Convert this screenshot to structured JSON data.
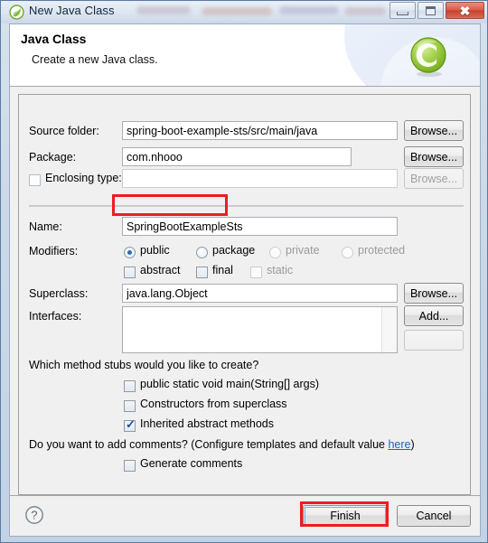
{
  "window": {
    "title": "New Java Class",
    "title_icon": "spring-leaf-icon",
    "minimize_label": "Minimize",
    "maximize_label": "Maximize",
    "close_label": "Close"
  },
  "banner": {
    "title": "Java Class",
    "subtitle": "Create a new Java class.",
    "icon": "java-class-icon"
  },
  "form": {
    "source_folder": {
      "label": "Source folder:",
      "value": "spring-boot-example-sts/src/main/java",
      "browse_label": "Browse..."
    },
    "package": {
      "label": "Package:",
      "value": "com.nhooo",
      "browse_label": "Browse..."
    },
    "enclosing_type": {
      "label": "Enclosing type:",
      "value": "",
      "checked": false,
      "browse_label": "Browse..."
    },
    "name": {
      "label": "Name:",
      "value": "SpringBootExampleSts"
    },
    "modifiers": {
      "label": "Modifiers:",
      "radios": [
        {
          "label": "public",
          "selected": true,
          "enabled": true
        },
        {
          "label": "package",
          "selected": false,
          "enabled": true
        },
        {
          "label": "private",
          "selected": false,
          "enabled": false
        },
        {
          "label": "protected",
          "selected": false,
          "enabled": false
        }
      ],
      "checkboxes": [
        {
          "label": "abstract",
          "checked": false,
          "enabled": true
        },
        {
          "label": "final",
          "checked": false,
          "enabled": true
        },
        {
          "label": "static",
          "checked": false,
          "enabled": false
        }
      ]
    },
    "superclass": {
      "label": "Superclass:",
      "value": "java.lang.Object",
      "browse_label": "Browse..."
    },
    "interfaces": {
      "label": "Interfaces:",
      "items": [],
      "add_label": "Add...",
      "remove_label": ""
    },
    "method_stubs": {
      "question": "Which method stubs would you like to create?",
      "options": [
        {
          "label": "public static void main(String[] args)",
          "checked": false
        },
        {
          "label": "Constructors from superclass",
          "checked": false
        },
        {
          "label": "Inherited abstract methods",
          "checked": true
        }
      ]
    },
    "comments": {
      "question_prefix": "Do you want to add comments? (Configure templates and default value ",
      "link": "here",
      "question_suffix": ")",
      "options": [
        {
          "label": "Generate comments",
          "checked": false
        }
      ]
    }
  },
  "footer": {
    "help_icon": "help-question-icon",
    "finish_label": "Finish",
    "cancel_label": "Cancel"
  },
  "colors": {
    "accent_red": "#ee1c23",
    "link_blue": "#1763c6",
    "icon_green": "#8dc63f",
    "focus_blue": "#6fb3e0"
  }
}
